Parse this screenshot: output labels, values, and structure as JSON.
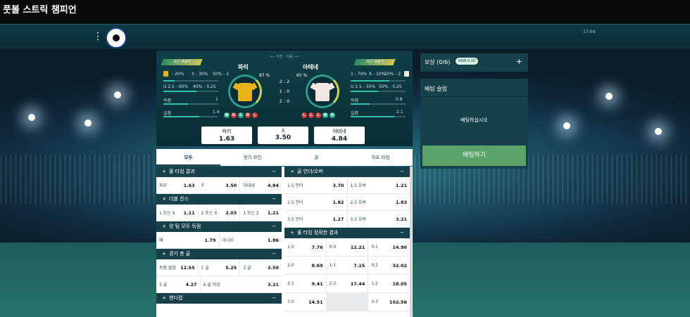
{
  "window": {
    "title": "풋볼 스트릭 챔피언"
  },
  "topnav": {
    "time": "17:04"
  },
  "match": {
    "nav": {
      "prev": "이전",
      "next": "다음"
    },
    "home": {
      "name": "파리",
      "badge": "최근 마경기",
      "jersey_color": "#e8b21a",
      "win_pct": "87 %",
      "stats": [
        {
          "left": "- 20%",
          "mid": "X - 30%",
          "right": "50% - 2"
        },
        {
          "left": "U 2.5 - 60%",
          "right": "40% - 0.25"
        }
      ],
      "goals": {
        "label": "득점",
        "value": "1"
      },
      "conceded": {
        "label": "실점",
        "value": "1.4"
      },
      "form": [
        "W",
        "D",
        "L",
        "D",
        "L"
      ]
    },
    "away": {
      "name": "아테네",
      "badge": "최근 마경기",
      "jersey_color": "#f1e8e2",
      "win_pct": "65 %",
      "stats": [
        {
          "left": "1 - 70%",
          "mid": "X - 10%",
          "right": "20% - 2"
        },
        {
          "left": "U 2.5 - 50%",
          "right": "50% - 0.25"
        }
      ],
      "goals": {
        "label": "득점",
        "value": "0.8"
      },
      "conceded": {
        "label": "실점",
        "value": "2.1"
      },
      "form": [
        "L",
        "L",
        "L",
        "W",
        "D"
      ]
    },
    "scores": [
      "2 : 2",
      "1 : 0",
      "2 : 0"
    ],
    "odds": [
      {
        "label": "파리",
        "value": "1.63"
      },
      {
        "label": "X",
        "value": "3.50"
      },
      {
        "label": "아테네",
        "value": "4.84"
      }
    ]
  },
  "tabs": [
    "모두",
    "경기 라인",
    "골",
    "하프 타임"
  ],
  "markets_left": [
    {
      "title": "풀 타임 결과",
      "rows": [
        [
          [
            "파리",
            "1.63"
          ],
          [
            "X",
            "3.50"
          ],
          [
            "아테네",
            "4.84"
          ]
        ]
      ]
    },
    {
      "title": "더블 찬스",
      "rows": [
        [
          [
            "1 또는 X",
            "1.11"
          ],
          [
            "2 또는 X",
            "2.03"
          ],
          [
            "1 또는 2",
            "1.21"
          ]
        ]
      ]
    },
    {
      "title": "양 팀 모두 득점",
      "rows": [
        [
          [
            "예",
            "1.79"
          ],
          [
            "아니오",
            "1.86"
          ]
        ]
      ]
    },
    {
      "title": "경기 총 골",
      "rows": [
        [
          [
            "득점 없음",
            "12.55"
          ],
          [
            "1 골",
            "5.25"
          ],
          [
            "2 골",
            "3.59"
          ]
        ],
        [
          [
            "3 골",
            "4.27"
          ],
          [
            "4 골 이상",
            "3.21"
          ]
        ]
      ]
    },
    {
      "title": "핸디캡",
      "rows": []
    }
  ],
  "markets_right": [
    {
      "title": "골 언더/오버",
      "rows": [
        [
          [
            "1.5 언더",
            "3.70"
          ],
          [
            "1.5 오버",
            "1.21"
          ]
        ],
        [
          [
            "2.5 언더",
            "1.82"
          ],
          [
            "2.5 오버",
            "1.83"
          ]
        ],
        [
          [
            "3.5 언더",
            "1.27"
          ],
          [
            "3.5 오버",
            "3.21"
          ]
        ]
      ]
    },
    {
      "title": "풀 타임 정확한 결과",
      "rows": [
        [
          [
            "1:0",
            "7.76"
          ],
          [
            "0:0",
            "12.21"
          ],
          [
            "0:1",
            "14.90"
          ]
        ],
        [
          [
            "2:0",
            "8.69"
          ],
          [
            "1:1",
            "7.15"
          ],
          [
            "0:2",
            "32.02"
          ]
        ],
        [
          [
            "2:1",
            "9.41"
          ],
          [
            "2:2",
            "17.44"
          ],
          [
            "1:2",
            "18.05"
          ]
        ],
        [
          [
            "3:0",
            "14.51"
          ],
          null,
          [
            "0:3",
            "102.56"
          ]
        ]
      ]
    }
  ],
  "rewards": {
    "label": "보상 (0/6)",
    "currency": "KRW 0.00"
  },
  "slip": {
    "title": "베팅 슬립",
    "empty": "베팅하십시오",
    "button": "베팅하기"
  }
}
